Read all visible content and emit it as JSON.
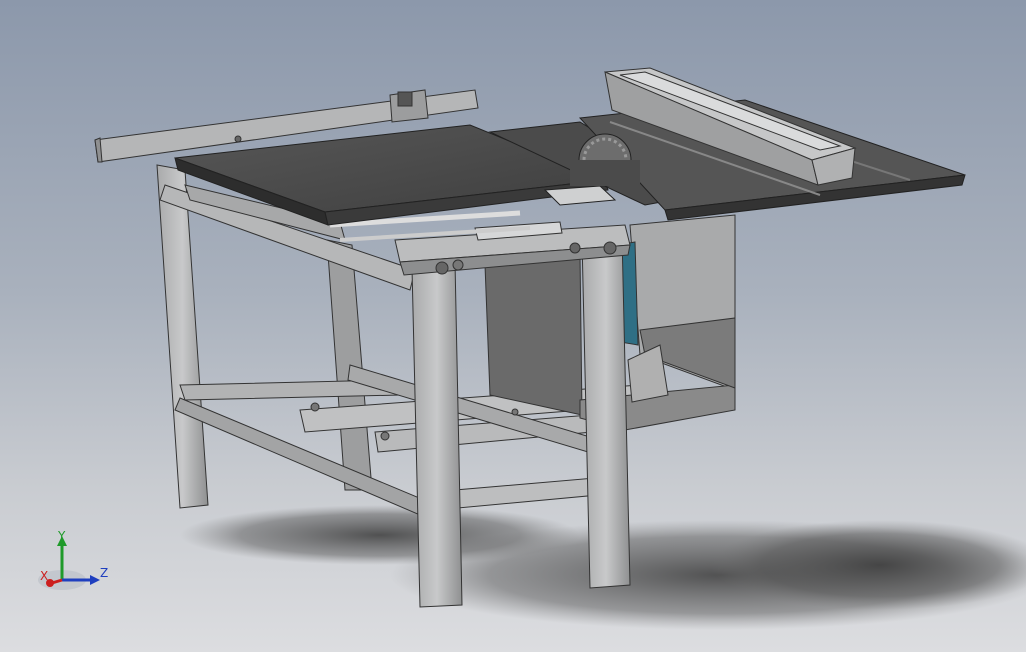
{
  "viewport": {
    "background_top": "#8c98ab",
    "background_bottom": "#dcdde0"
  },
  "model": {
    "icon": "table-saw-3d-model"
  },
  "triad": {
    "x_label": "X",
    "y_label": "Y",
    "z_label": "Z",
    "x_color": "#cc1f1f",
    "y_color": "#1f9a2a",
    "z_color": "#1f3fbf"
  }
}
